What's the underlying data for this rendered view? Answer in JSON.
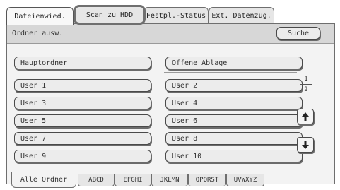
{
  "tabs": [
    {
      "label": "Dateienwied.",
      "state": "active"
    },
    {
      "label": "Scan zu HDD",
      "state": "selected"
    },
    {
      "label": "Festpl.-Status",
      "state": "normal"
    },
    {
      "label": "Ext. Datenzug.",
      "state": "normal"
    }
  ],
  "folder_bar": {
    "label": "Ordner ausw.",
    "search_button": "Suche"
  },
  "main_folders": [
    "Hauptordner",
    "Offene Ablage"
  ],
  "users": [
    "User 1",
    "User 2",
    "User 3",
    "User 4",
    "User 5",
    "User 6",
    "User 7",
    "User 8",
    "User 9",
    "User 10"
  ],
  "pager": {
    "current": "1",
    "total": "2",
    "up_icon": "arrow-up-icon",
    "down_icon": "arrow-down-icon"
  },
  "bottom_tabs": [
    "Alle Ordner",
    "ABCD",
    "EFGHI",
    "JKLMN",
    "OPQRST",
    "UVWXYZ"
  ]
}
